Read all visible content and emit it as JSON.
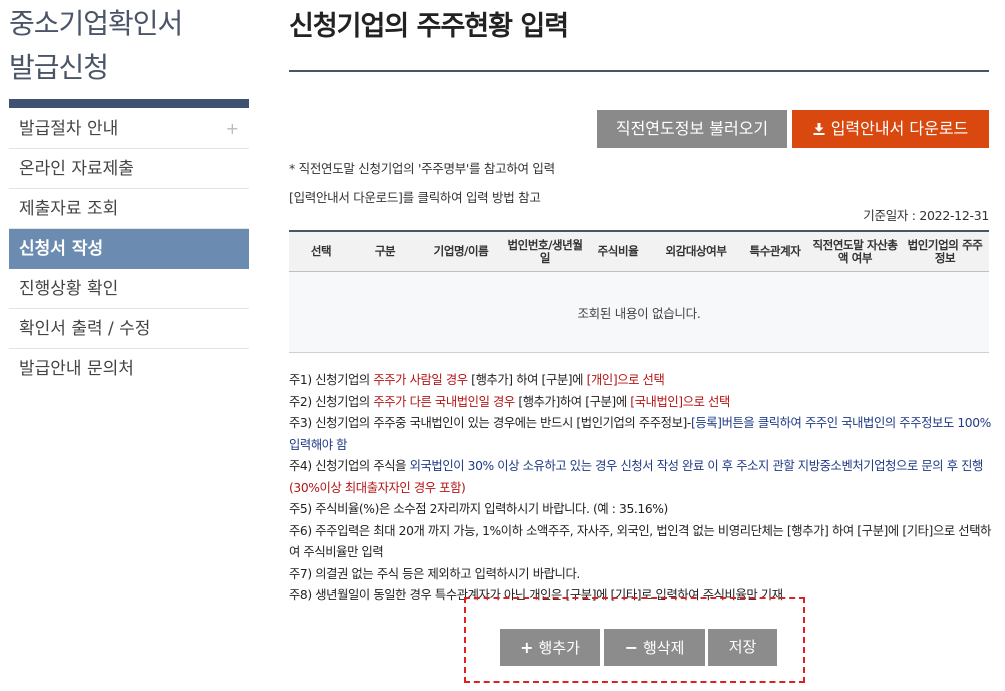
{
  "sidebar": {
    "title_line1": "중소기업확인서",
    "title_line2": "발급신청",
    "items": [
      {
        "label": "발급절차 안내",
        "expand": "+"
      },
      {
        "label": "온라인 자료제출"
      },
      {
        "label": "제출자료 조회"
      },
      {
        "label": "신청서 작성"
      },
      {
        "label": "진행상황 확인"
      },
      {
        "label": "확인서 출력 / 수정"
      },
      {
        "label": "발급안내 문의처"
      }
    ],
    "active_item": "신청서 작성"
  },
  "header": {
    "title": "신청기업의 주주현황 입력"
  },
  "toolbar": {
    "prev_year_button": "직전연도정보 불러오기",
    "download_button": "입력안내서 다운로드"
  },
  "notes_top": {
    "line1": "* 직전연도말 신청기업의 '주주명부'를 참고하여 입력",
    "line2": "[입력안내서 다운로드]를 클릭하여 입력 방법 참고",
    "base_date": "기준일자 : 2022-12-31"
  },
  "table": {
    "headers": [
      "선택",
      "구분",
      "기업명/이름",
      "법인번호/생년월일",
      "주식비율",
      "외감대상여부",
      "특수관계자",
      "직전연도말 자산총액 여부",
      "법인기업의 주주정보"
    ],
    "empty_message": "조회된 내용이 없습니다."
  },
  "notes": {
    "n1": {
      "a": "주1) 신청기업의 ",
      "b": "주주가 사람일 경우",
      "c": " [행추가] 하여 [구분]에 ",
      "d": "[개인]으로 선택"
    },
    "n2": {
      "a": "주2) 신청기업의 ",
      "b": "주주가 다른 국내법인일 경우",
      "c": " [행추가]하여 [구분]에 ",
      "d": "[국내법인]으로 선택"
    },
    "n3": {
      "a": "주3) 신청기업의 주주중 국내법인이 있는 경우에는 반드시 [법인기업의 주주정보]-",
      "b": "[등록]버튼을 클릭하여 주주인 국내법인의 주주정보도 100% 입력해야 함"
    },
    "n4": {
      "a": "주4) 신청기업의 주식을 ",
      "b": "외국법인이 30% 이상 소유하고 있는 경우 신청서 작성 완료 이 후 주소지 관할 지방중소벤처기업청으로 문의 후 진행",
      "c": "(30%이상 최대출자자인 경우 포함)"
    },
    "n5": "주5) 주식비율(%)은 소수점 2자리까지 입력하시기 바랍니다. (예 : 35.16%)",
    "n6": "주6) 주주입력은 최대 20개 까지 가능, 1%이하 소액주주, 자사주, 외국인, 법인격 없는 비영리단체는 [행추가] 하여 [구분]에 [기타]으로 선택하여 주식비율만 입력",
    "n7": "주7) 의결권 없는 주식 등은 제외하고 입력하시기 바랍니다.",
    "n8": "주8) 생년월일이 동일한 경우 특수관계자가 아닌 개인은 [구분]에 [기타]로 입력하여 주식비율만 기재"
  },
  "actions": {
    "add_row": "행추가",
    "delete_row": "행삭제",
    "save": "저장"
  },
  "colors": {
    "sidebar_active": "#6b8cb0",
    "header_rule": "#4a5568",
    "download_button": "#d9480f",
    "gray_button": "#8c8c8c",
    "highlight_red": "#b41414",
    "highlight_blue": "#1f3a86",
    "dashed_box": "#e02020"
  }
}
